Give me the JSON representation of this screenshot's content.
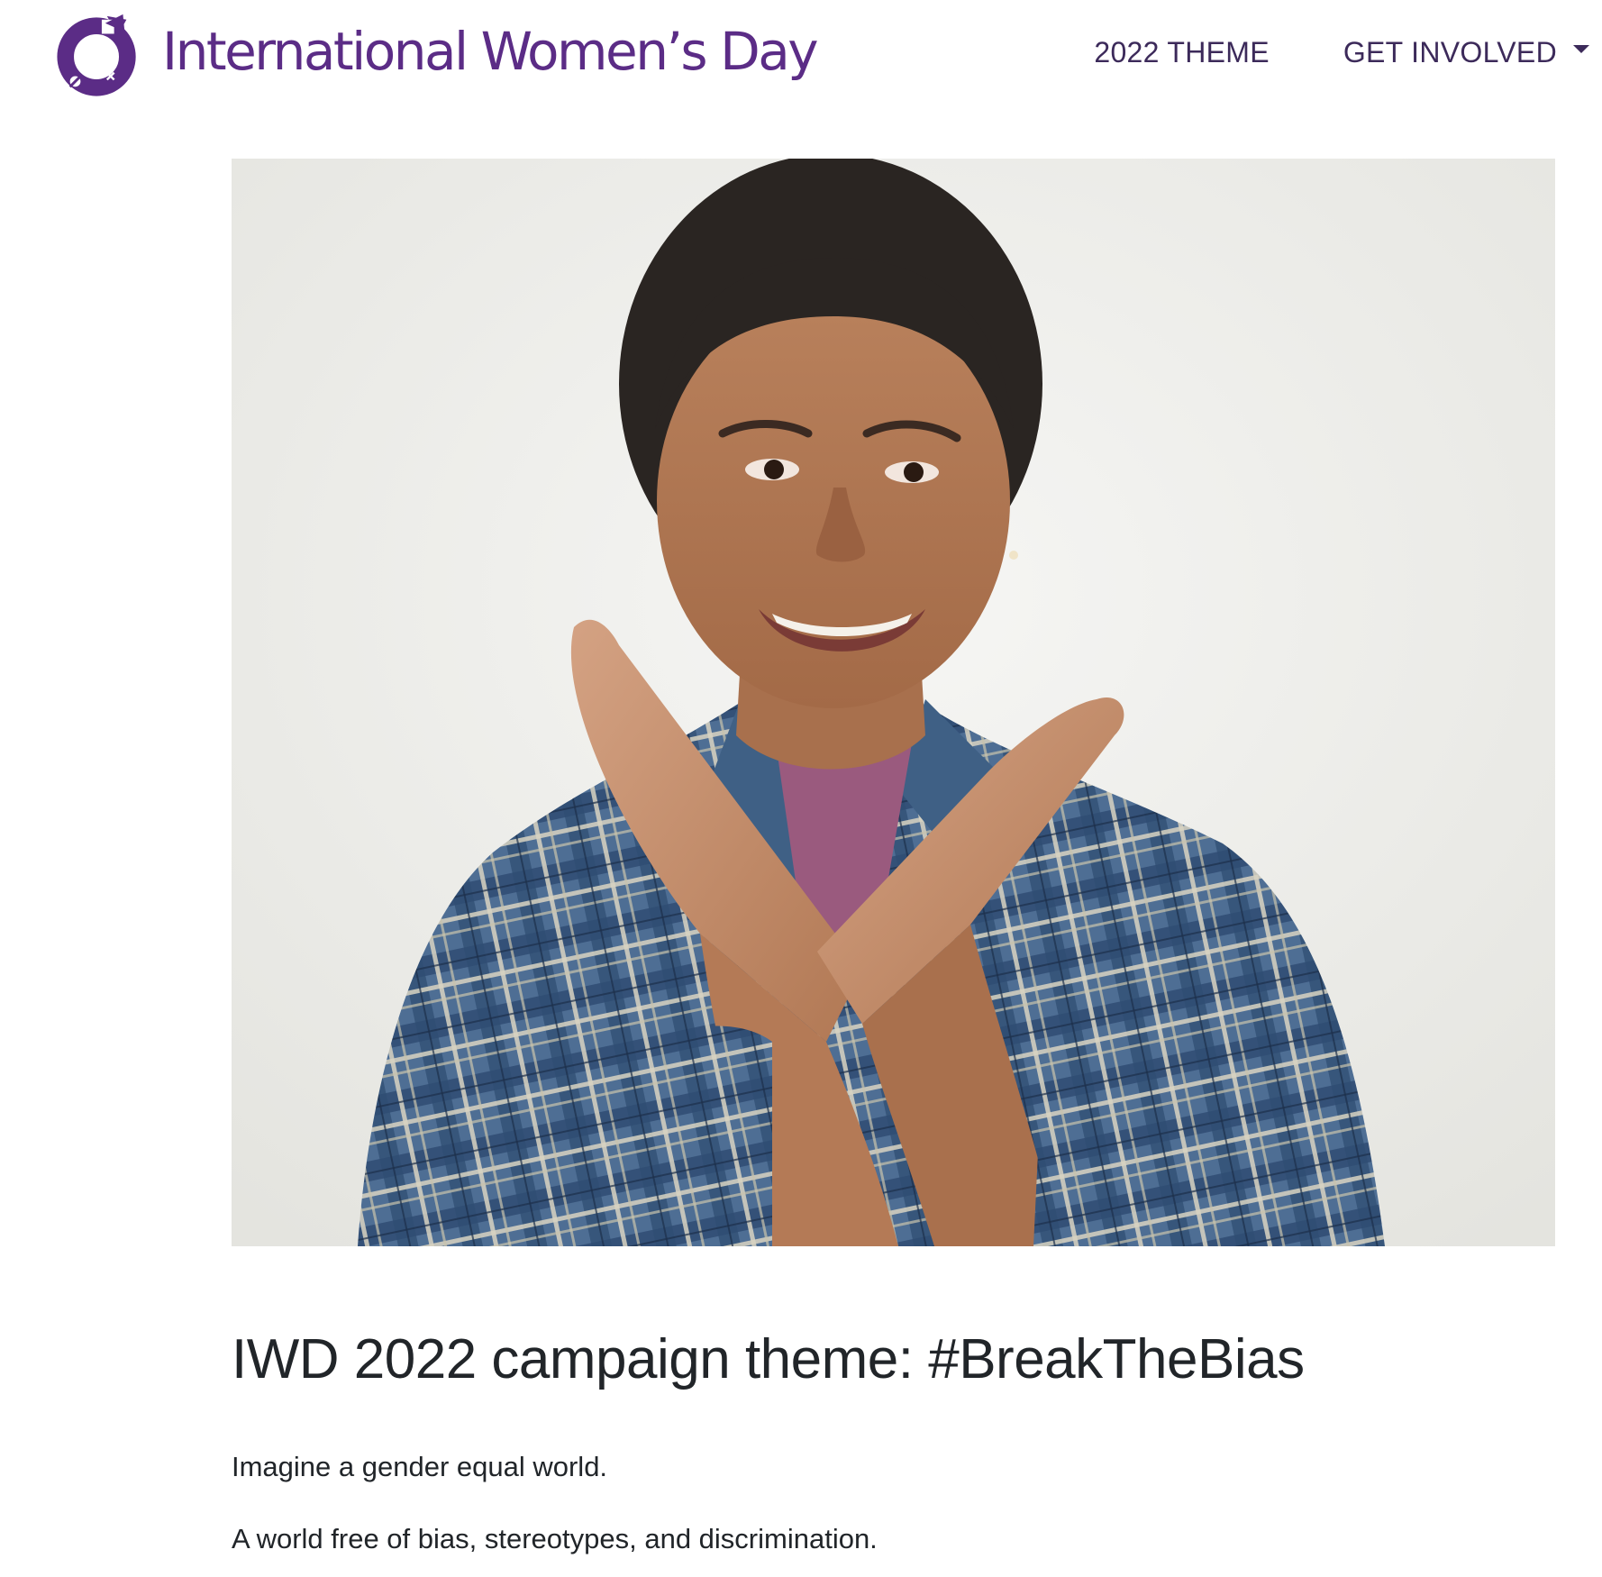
{
  "header": {
    "logo_text": "International Women’s Day",
    "nav": {
      "theme_label": "2022 THEME",
      "get_involved_label": "GET INVOLVED"
    }
  },
  "colors": {
    "brand_purple": "#5b2c86",
    "nav_text": "#3c2a5a",
    "body_text": "#212529"
  },
  "icons": {
    "logo": "iwd-venus-symbol-icon",
    "dropdown": "caret-down-icon"
  },
  "hero": {
    "image_description": "Smiling woman in blue plaid shirt crossing her arms in an X gesture"
  },
  "article": {
    "title": "IWD 2022 campaign theme: #BreakTheBias",
    "paragraphs": [
      "Imagine a gender equal world.",
      "A world free of bias, stereotypes, and discrimination."
    ]
  }
}
